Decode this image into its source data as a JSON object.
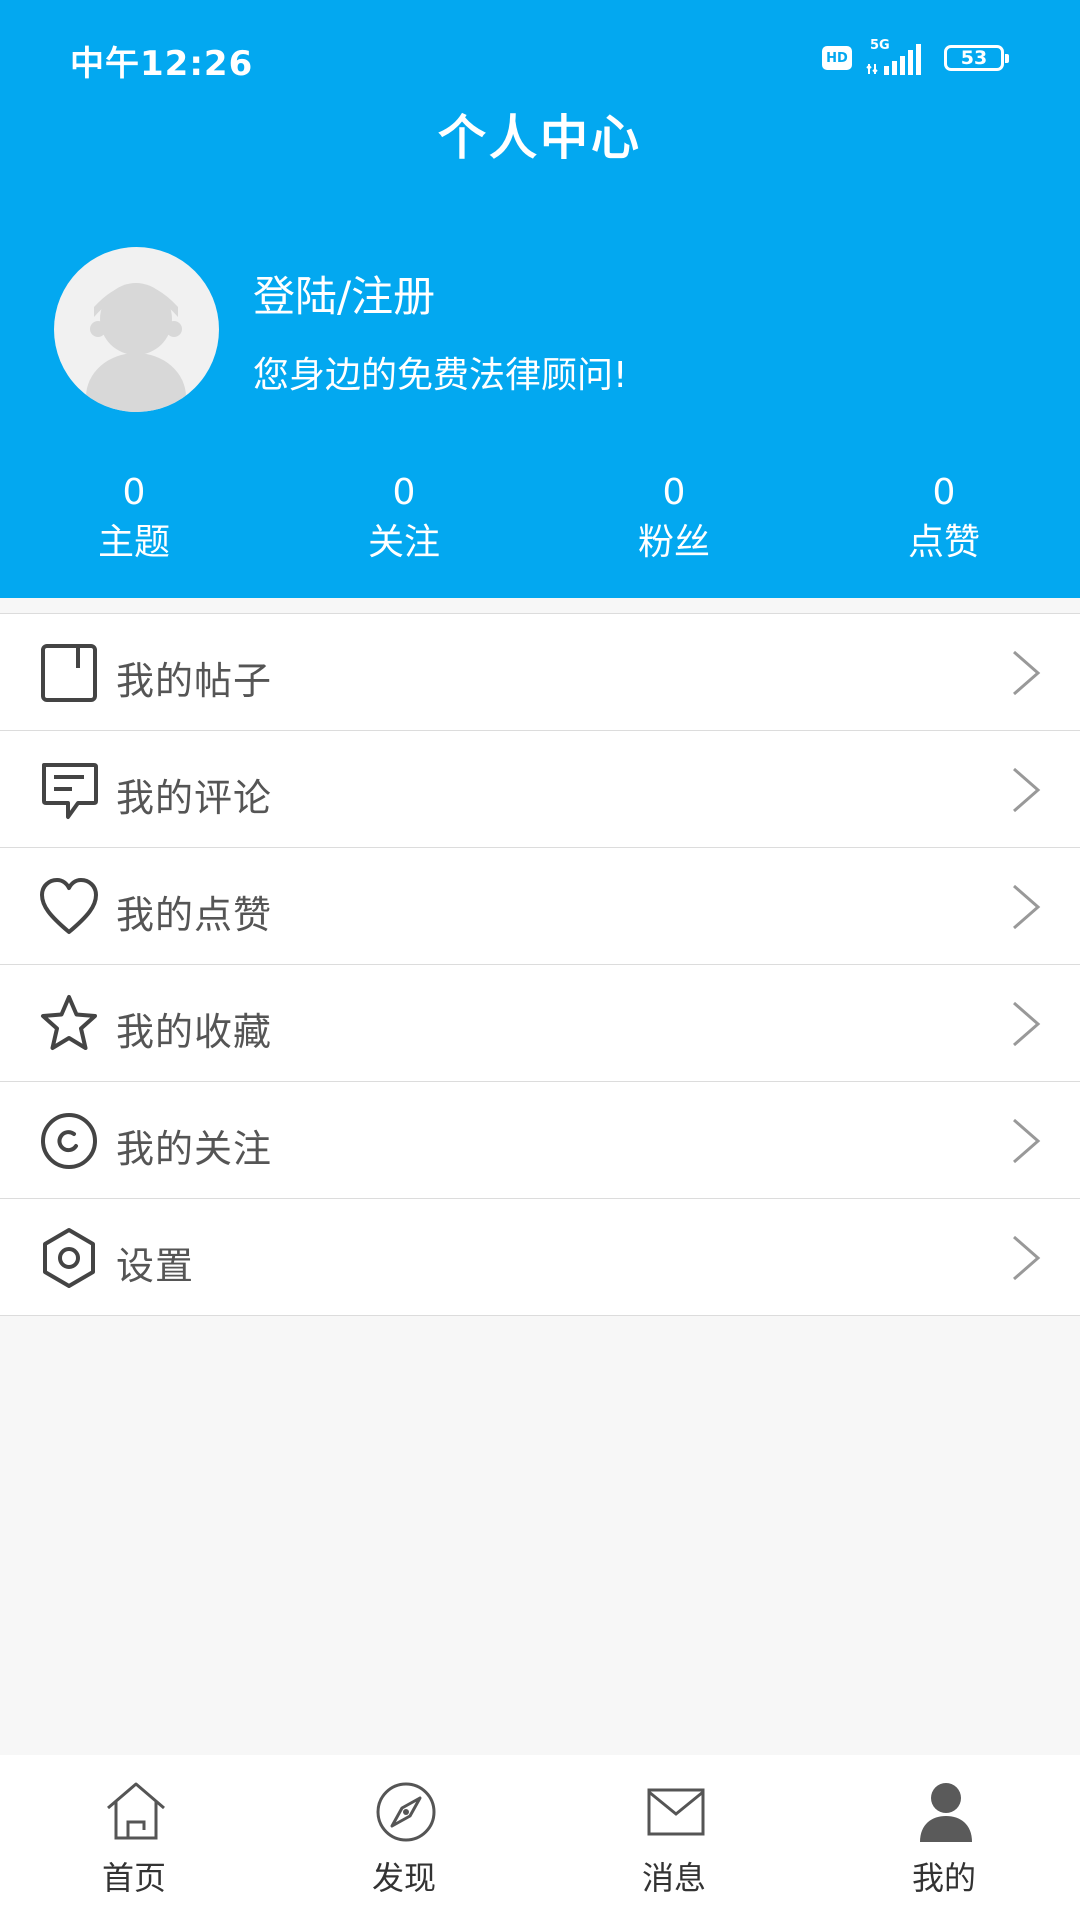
{
  "status_bar": {
    "time": "中午12:26",
    "hd": "HD",
    "network": "5G",
    "battery": "53"
  },
  "header": {
    "title": "个人中心",
    "login_label": "登陆/注册",
    "tagline": "您身边的免费法律顾问!"
  },
  "stats": [
    {
      "value": "0",
      "label": "主题"
    },
    {
      "value": "0",
      "label": "关注"
    },
    {
      "value": "0",
      "label": "粉丝"
    },
    {
      "value": "0",
      "label": "点赞"
    }
  ],
  "menu": [
    {
      "label": "我的帖子",
      "icon": "document-icon"
    },
    {
      "label": "我的评论",
      "icon": "comment-icon"
    },
    {
      "label": "我的点赞",
      "icon": "heart-icon"
    },
    {
      "label": "我的收藏",
      "icon": "star-icon"
    },
    {
      "label": "我的关注",
      "icon": "follow-icon"
    },
    {
      "label": "设置",
      "icon": "settings-icon"
    }
  ],
  "tabs": [
    {
      "label": "首页",
      "icon": "home-icon",
      "active": false
    },
    {
      "label": "发现",
      "icon": "compass-icon",
      "active": false
    },
    {
      "label": "消息",
      "icon": "mail-icon",
      "active": false
    },
    {
      "label": "我的",
      "icon": "user-icon",
      "active": true
    }
  ],
  "colors": {
    "header_bg": "#03a8f0",
    "menu_text": "#555555",
    "icon": "#444444",
    "chevron": "#999999",
    "tab_text": "#333333"
  }
}
